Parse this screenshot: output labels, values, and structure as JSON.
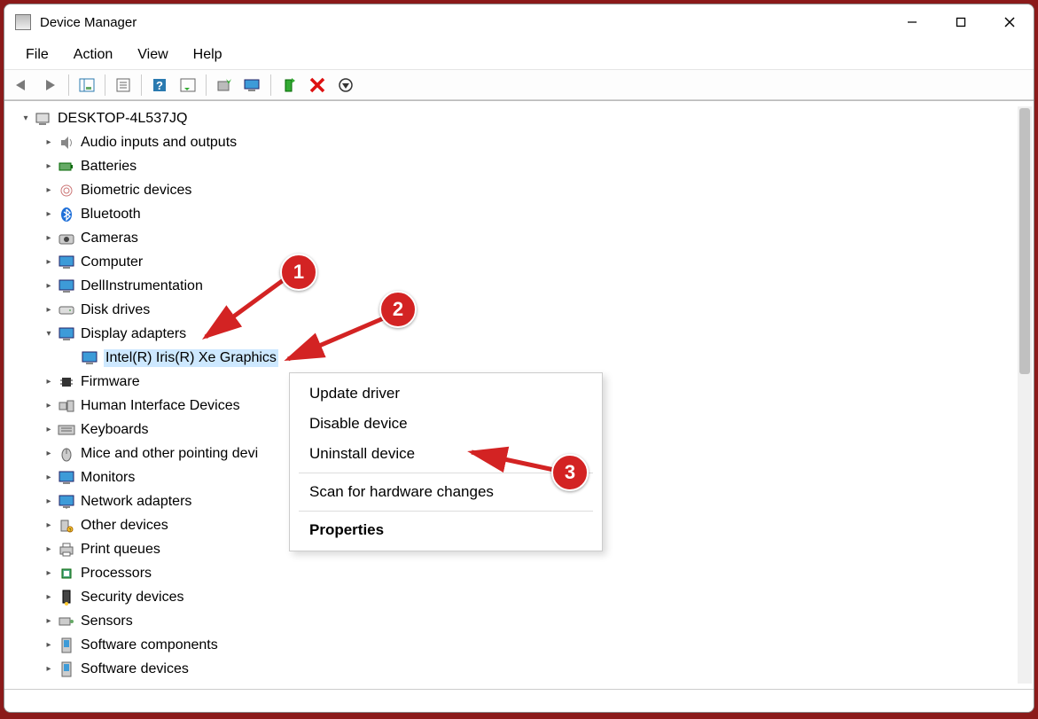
{
  "window": {
    "title": "Device Manager"
  },
  "menubar": {
    "file": "File",
    "action": "Action",
    "view": "View",
    "help": "Help"
  },
  "toolbar": {
    "back": "Back",
    "forward": "Forward",
    "show_hide_tree": "Show/Hide Console Tree",
    "properties": "Properties",
    "help": "Help",
    "action_view": "Action View",
    "update_driver": "Update Device Driver",
    "scan": "Scan for hardware changes",
    "enable": "Enable Device",
    "uninstall": "Uninstall Device",
    "add_legacy": "Add legacy hardware"
  },
  "tree": {
    "root": "DESKTOP-4L537JQ",
    "items": [
      {
        "label": "Audio inputs and outputs",
        "icon": "speaker"
      },
      {
        "label": "Batteries",
        "icon": "battery"
      },
      {
        "label": "Biometric devices",
        "icon": "fingerprint"
      },
      {
        "label": "Bluetooth",
        "icon": "bluetooth"
      },
      {
        "label": "Cameras",
        "icon": "camera"
      },
      {
        "label": "Computer",
        "icon": "monitor"
      },
      {
        "label": "DellInstrumentation",
        "icon": "monitor"
      },
      {
        "label": "Disk drives",
        "icon": "disk"
      },
      {
        "label": "Display adapters",
        "icon": "display",
        "expanded": true,
        "children": [
          {
            "label": "Intel(R) Iris(R) Xe Graphics",
            "icon": "display",
            "selected": true
          }
        ]
      },
      {
        "label": "Firmware",
        "icon": "chip"
      },
      {
        "label": "Human Interface Devices",
        "icon": "hid"
      },
      {
        "label": "Keyboards",
        "icon": "keyboard"
      },
      {
        "label": "Mice and other pointing devices",
        "icon": "mouse",
        "truncated": "Mice and other pointing devi"
      },
      {
        "label": "Monitors",
        "icon": "monitor"
      },
      {
        "label": "Network adapters",
        "icon": "network"
      },
      {
        "label": "Other devices",
        "icon": "other"
      },
      {
        "label": "Print queues",
        "icon": "printer"
      },
      {
        "label": "Processors",
        "icon": "cpu"
      },
      {
        "label": "Security devices",
        "icon": "security"
      },
      {
        "label": "Sensors",
        "icon": "sensor"
      },
      {
        "label": "Software components",
        "icon": "software"
      },
      {
        "label": "Software devices",
        "icon": "software"
      }
    ]
  },
  "context_menu": {
    "update_driver": "Update driver",
    "disable_device": "Disable device",
    "uninstall_device": "Uninstall device",
    "scan_hardware": "Scan for hardware changes",
    "properties": "Properties"
  },
  "annotations": {
    "one": "1",
    "two": "2",
    "three": "3"
  }
}
